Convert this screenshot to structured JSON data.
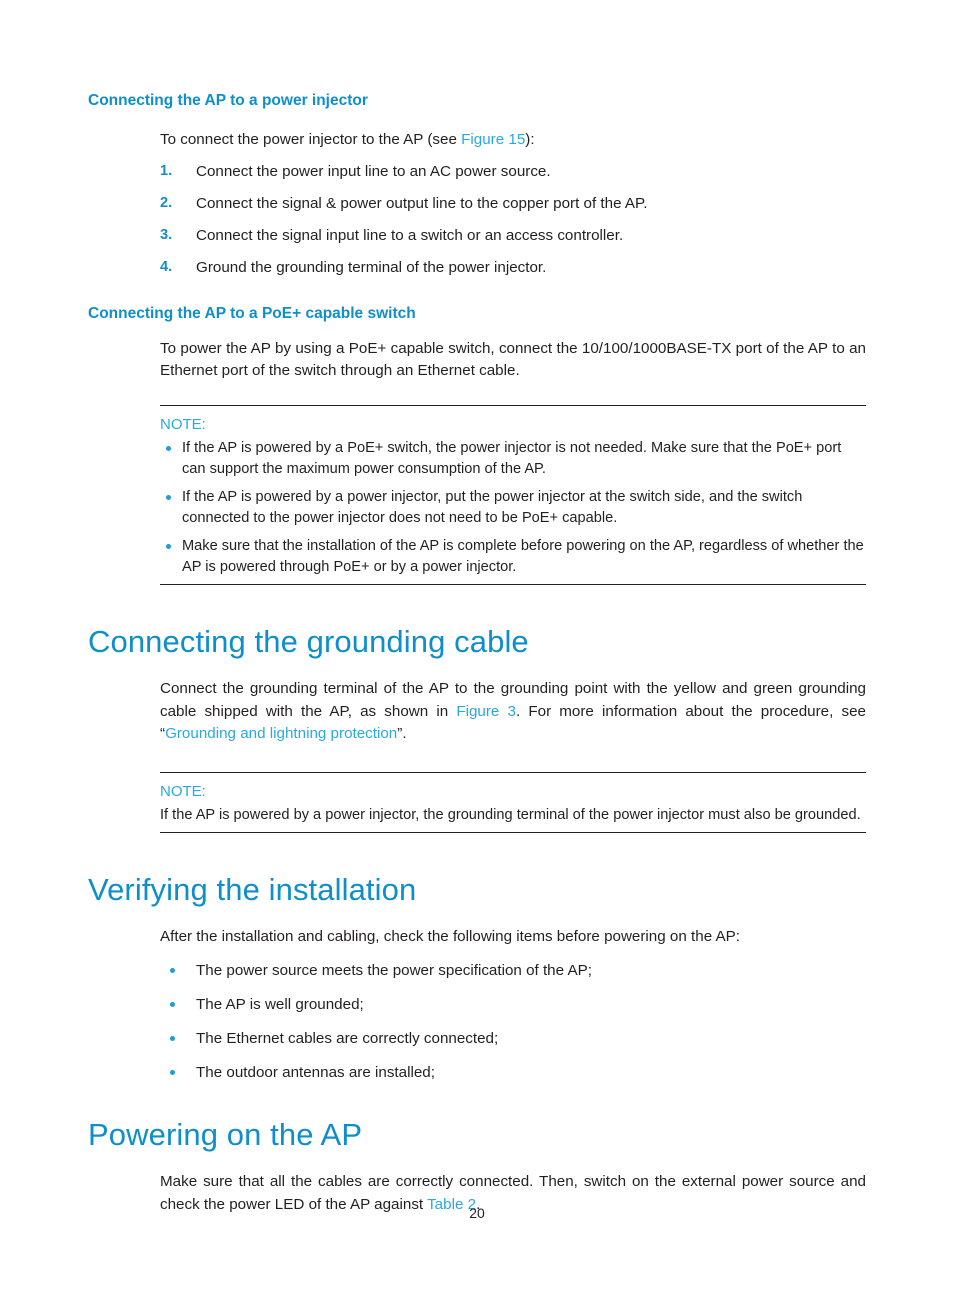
{
  "document": {
    "page_number": "20",
    "colors": {
      "heading_blue": "#0e8fcc",
      "link_blue": "#2aa9e0",
      "bullet_blue": "#1b9dd9",
      "body_text": "#231f20"
    }
  },
  "sections": {
    "power_injector": {
      "heading": "Connecting the AP to a power injector",
      "intro_before_link": "To connect the power injector to the AP (see ",
      "intro_link": "Figure 15",
      "intro_after_link": "):",
      "steps": [
        {
          "number": "1.",
          "text": "Connect the power input line to an AC power source."
        },
        {
          "number": "2.",
          "text": "Connect the signal & power output line to the copper port of the AP."
        },
        {
          "number": "3.",
          "text": "Connect the signal input line to a switch or an access controller."
        },
        {
          "number": "4.",
          "text": "Ground the grounding terminal of the power injector."
        }
      ]
    },
    "poe_switch": {
      "heading": "Connecting the AP to a PoE+ capable switch",
      "paragraph": "To power the AP by using a PoE+ capable switch, connect the 10/100/1000BASE-TX port of the AP to an Ethernet port of the switch through an Ethernet cable.",
      "note": {
        "label": "NOTE:",
        "bullets": [
          "If the AP is powered by a PoE+ switch, the power injector is not needed. Make sure that the PoE+ port can support the maximum power consumption of the AP.",
          "If the AP is powered by a power injector, put the power injector at the switch side, and the switch connected to the power injector does not need to be PoE+ capable.",
          "Make sure that the installation of the AP is complete before powering on the AP, regardless of whether the AP is powered through PoE+ or by a power injector."
        ]
      }
    },
    "grounding_cable": {
      "heading": "Connecting the grounding cable",
      "paragraph_part1": "Connect the grounding terminal of the AP to the grounding point with the yellow and green grounding cable shipped with the AP, as shown in ",
      "paragraph_link1": "Figure 3",
      "paragraph_part2": ". For more information about the procedure, see “",
      "paragraph_link2": "Grounding and lightning protection",
      "paragraph_part3": "”.",
      "note": {
        "label": "NOTE:",
        "text": "If the AP is powered by a power injector, the grounding terminal of the power injector must also be grounded."
      }
    },
    "verifying": {
      "heading": "Verifying the installation",
      "intro": "After the installation and cabling, check the following items before powering on the AP:",
      "bullets": [
        "The power source meets the power specification of the AP;",
        "The AP is well grounded;",
        "The Ethernet cables are correctly connected;",
        "The outdoor antennas are installed;"
      ]
    },
    "powering_on": {
      "heading": "Powering on the AP",
      "paragraph_part1": "Make sure that all the cables are correctly connected. Then, switch on the external power source and check the power LED of the AP against ",
      "paragraph_link": "Table 2",
      "paragraph_part2": "."
    }
  }
}
